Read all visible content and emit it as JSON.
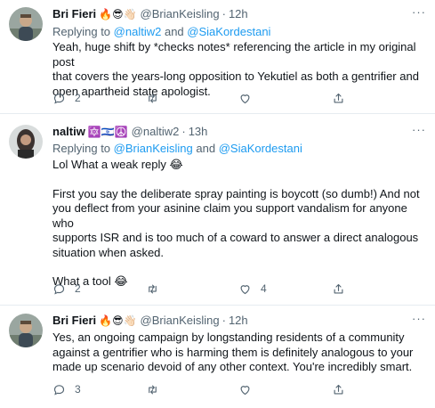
{
  "tweets": [
    {
      "name": "Bri Fieri",
      "name_emoji": "🔥😎👋🏻",
      "handle": "@BrianKeisling",
      "separator": "·",
      "time": "12h",
      "more": "···",
      "reply_prefix": "Replying to",
      "reply_mention_1": "@naltiw2",
      "reply_and": "and",
      "reply_mention_2": "@SiaKordestani",
      "body_lines": [
        "Yeah, huge shift by *checks notes* referencing the article in my original post",
        "that covers the years-long opposition to Yekutiel as both a gentrifier and",
        "open apartheid state apologist."
      ],
      "actions": {
        "reply": "2",
        "retweet": "",
        "like": "",
        "share": ""
      }
    },
    {
      "name": "naltiw",
      "name_emoji": "🔯🇮🇱☮️",
      "handle": "@naltiw2",
      "separator": "·",
      "time": "13h",
      "more": "···",
      "reply_prefix": "Replying to",
      "reply_mention_1": "@BrianKeisling",
      "reply_and": "and",
      "reply_mention_2": "@SiaKordestani",
      "body_para_1": "Lol What a weak reply 😂",
      "body_para_2_lines": [
        "First you say the deliberate spray painting is boycott (so dumb!) And not",
        "you deflect from your asinine claim you support vandalism for anyone who",
        "supports ISR and is too much of a coward to answer a direct analogous",
        "situation when asked."
      ],
      "body_para_3": "What a tool 😂",
      "actions": {
        "reply": "2",
        "retweet": "",
        "like": "4",
        "share": ""
      }
    },
    {
      "name": "Bri Fieri",
      "name_emoji": "🔥😎👋🏻",
      "handle": "@BrianKeisling",
      "separator": "·",
      "time": "12h",
      "more": "···",
      "body_lines": [
        "Yes, an ongoing campaign by longstanding residents of a community",
        "against a gentrifier who is harming them is definitely analogous to your",
        "made up scenario devoid of any other context. You're incredibly smart."
      ],
      "actions": {
        "reply": "3",
        "retweet": "",
        "like": "",
        "share": ""
      }
    }
  ],
  "icons": {
    "reply": "reply-icon",
    "retweet": "retweet-icon",
    "like": "heart-icon",
    "share": "share-icon",
    "more": "more-icon"
  },
  "colors": {
    "text": "#0f1419",
    "secondary": "#536471",
    "link": "#1d9bf0",
    "divider": "#e6ecf0",
    "thread_line": "#cfd9de"
  }
}
